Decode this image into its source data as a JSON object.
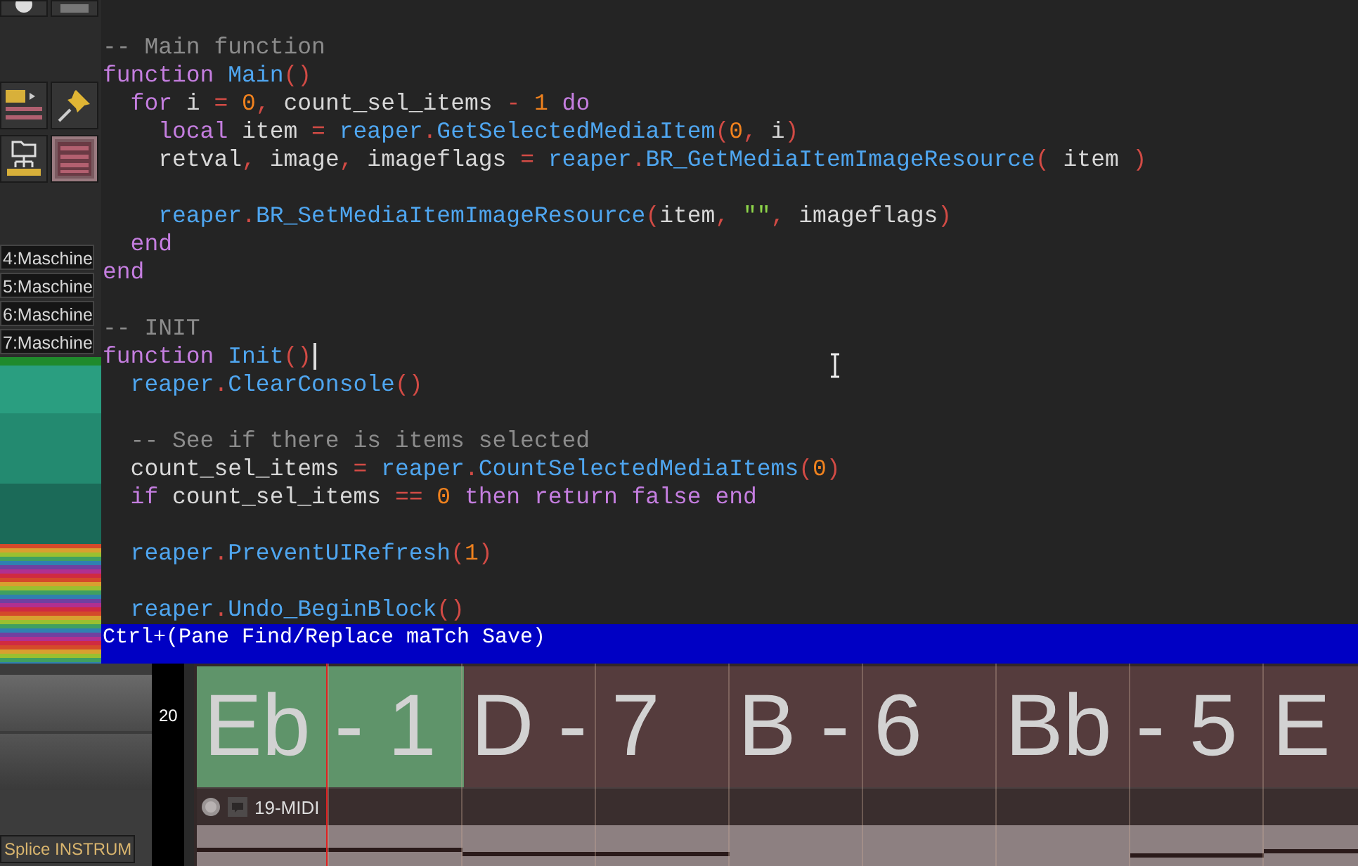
{
  "sidebar": {
    "toolbar_buttons": [
      {
        "selected": false
      },
      {
        "selected": false
      },
      {
        "selected": false
      },
      {
        "selected": false
      },
      {
        "selected": false
      },
      {
        "selected": true
      }
    ],
    "track_labels": [
      "4:Maschine",
      "5:Maschine",
      "6:Maschine",
      "7:Maschine"
    ]
  },
  "editor": {
    "lines": [
      {
        "kind": "code",
        "caret": false,
        "tokens": [
          {
            "kind": "cmt",
            "text": "-- Main function"
          }
        ]
      },
      {
        "kind": "code",
        "caret": false,
        "tokens": [
          {
            "kind": "kw",
            "text": "function"
          },
          {
            "kind": "fn",
            "text": " Main"
          },
          {
            "kind": "op",
            "text": "()"
          }
        ]
      },
      {
        "kind": "code",
        "caret": false,
        "tokens": [
          {
            "kind": "kw",
            "text": "  for"
          },
          {
            "kind": "id",
            "text": " i "
          },
          {
            "kind": "op",
            "text": "="
          },
          {
            "kind": "num",
            "text": " 0"
          },
          {
            "kind": "op",
            "text": ","
          },
          {
            "kind": "id",
            "text": " count_sel_items "
          },
          {
            "kind": "op",
            "text": "-"
          },
          {
            "kind": "num",
            "text": " 1"
          },
          {
            "kind": "kw",
            "text": " do"
          }
        ]
      },
      {
        "kind": "code",
        "caret": false,
        "tokens": [
          {
            "kind": "kw",
            "text": "    local"
          },
          {
            "kind": "id",
            "text": " item "
          },
          {
            "kind": "op",
            "text": "="
          },
          {
            "kind": "fn",
            "text": " reaper"
          },
          {
            "kind": "op",
            "text": "."
          },
          {
            "kind": "fn",
            "text": "GetSelectedMediaItem"
          },
          {
            "kind": "op",
            "text": "("
          },
          {
            "kind": "num",
            "text": "0"
          },
          {
            "kind": "op",
            "text": ","
          },
          {
            "kind": "id",
            "text": " i"
          },
          {
            "kind": "op",
            "text": ")"
          }
        ]
      },
      {
        "kind": "code",
        "caret": false,
        "tokens": [
          {
            "kind": "id",
            "text": "    retval"
          },
          {
            "kind": "op",
            "text": ","
          },
          {
            "kind": "id",
            "text": " image"
          },
          {
            "kind": "op",
            "text": ","
          },
          {
            "kind": "id",
            "text": " imageflags "
          },
          {
            "kind": "op",
            "text": "="
          },
          {
            "kind": "fn",
            "text": " reaper"
          },
          {
            "kind": "op",
            "text": "."
          },
          {
            "kind": "fn",
            "text": "BR_GetMediaItemImageResource"
          },
          {
            "kind": "op",
            "text": "("
          },
          {
            "kind": "id",
            "text": " item "
          },
          {
            "kind": "op",
            "text": ")"
          }
        ]
      },
      {
        "kind": "blank"
      },
      {
        "kind": "code",
        "caret": false,
        "tokens": [
          {
            "kind": "fn",
            "text": "    reaper"
          },
          {
            "kind": "op",
            "text": "."
          },
          {
            "kind": "fn",
            "text": "BR_SetMediaItemImageResource"
          },
          {
            "kind": "op",
            "text": "("
          },
          {
            "kind": "id",
            "text": "item"
          },
          {
            "kind": "op",
            "text": ","
          },
          {
            "kind": "str",
            "text": " \"\""
          },
          {
            "kind": "op",
            "text": ","
          },
          {
            "kind": "id",
            "text": " imageflags"
          },
          {
            "kind": "op",
            "text": ")"
          }
        ]
      },
      {
        "kind": "code",
        "caret": false,
        "tokens": [
          {
            "kind": "kw",
            "text": "  end"
          }
        ]
      },
      {
        "kind": "code",
        "caret": false,
        "tokens": [
          {
            "kind": "kw",
            "text": "end"
          }
        ]
      },
      {
        "kind": "blank"
      },
      {
        "kind": "code",
        "caret": false,
        "tokens": [
          {
            "kind": "cmt",
            "text": "-- INIT"
          }
        ]
      },
      {
        "kind": "code",
        "caret": true,
        "tokens": [
          {
            "kind": "kw",
            "text": "function"
          },
          {
            "kind": "fn",
            "text": " Init"
          },
          {
            "kind": "op",
            "text": "()"
          }
        ]
      },
      {
        "kind": "code",
        "caret": false,
        "tokens": [
          {
            "kind": "fn",
            "text": "  reaper"
          },
          {
            "kind": "op",
            "text": "."
          },
          {
            "kind": "fn",
            "text": "ClearConsole"
          },
          {
            "kind": "op",
            "text": "()"
          }
        ]
      },
      {
        "kind": "blank"
      },
      {
        "kind": "code",
        "caret": false,
        "tokens": [
          {
            "kind": "cmt",
            "text": "  -- See if there is items selected"
          }
        ]
      },
      {
        "kind": "code",
        "caret": false,
        "tokens": [
          {
            "kind": "id",
            "text": "  count_sel_items "
          },
          {
            "kind": "op",
            "text": "="
          },
          {
            "kind": "fn",
            "text": " reaper"
          },
          {
            "kind": "op",
            "text": "."
          },
          {
            "kind": "fn",
            "text": "CountSelectedMediaItems"
          },
          {
            "kind": "op",
            "text": "("
          },
          {
            "kind": "num",
            "text": "0"
          },
          {
            "kind": "op",
            "text": ")"
          }
        ]
      },
      {
        "kind": "code",
        "caret": false,
        "tokens": [
          {
            "kind": "kw",
            "text": "  if"
          },
          {
            "kind": "id",
            "text": " count_sel_items "
          },
          {
            "kind": "op",
            "text": "=="
          },
          {
            "kind": "num",
            "text": " 0"
          },
          {
            "kind": "kw",
            "text": " then return false end"
          }
        ]
      },
      {
        "kind": "blank"
      },
      {
        "kind": "code",
        "caret": false,
        "tokens": [
          {
            "kind": "fn",
            "text": "  reaper"
          },
          {
            "kind": "op",
            "text": "."
          },
          {
            "kind": "fn",
            "text": "PreventUIRefresh"
          },
          {
            "kind": "op",
            "text": "("
          },
          {
            "kind": "num",
            "text": "1"
          },
          {
            "kind": "op",
            "text": ")"
          }
        ]
      },
      {
        "kind": "blank"
      },
      {
        "kind": "code",
        "caret": false,
        "tokens": [
          {
            "kind": "fn",
            "text": "  reaper"
          },
          {
            "kind": "op",
            "text": "."
          },
          {
            "kind": "fn",
            "text": "Undo_BeginBlock"
          },
          {
            "kind": "op",
            "text": "()"
          }
        ]
      }
    ],
    "status_bar": "Ctrl+(Pane Find/Replace maTch Save)"
  },
  "track_panel": {
    "instrument_button": "Splice INSTRUM"
  },
  "ruler": {
    "measure": "20"
  },
  "regions": [
    {
      "label": "Eb - 1",
      "color": "#5f946a"
    },
    {
      "label": "D - 7",
      "color": "#553c3d"
    },
    {
      "label": "B - 6",
      "color": "#553c3d"
    },
    {
      "label": "Bb - 5",
      "color": "#553c3d"
    },
    {
      "label": "E",
      "color": "#553c3d"
    }
  ],
  "midi_track": {
    "name": "19-MIDI"
  }
}
